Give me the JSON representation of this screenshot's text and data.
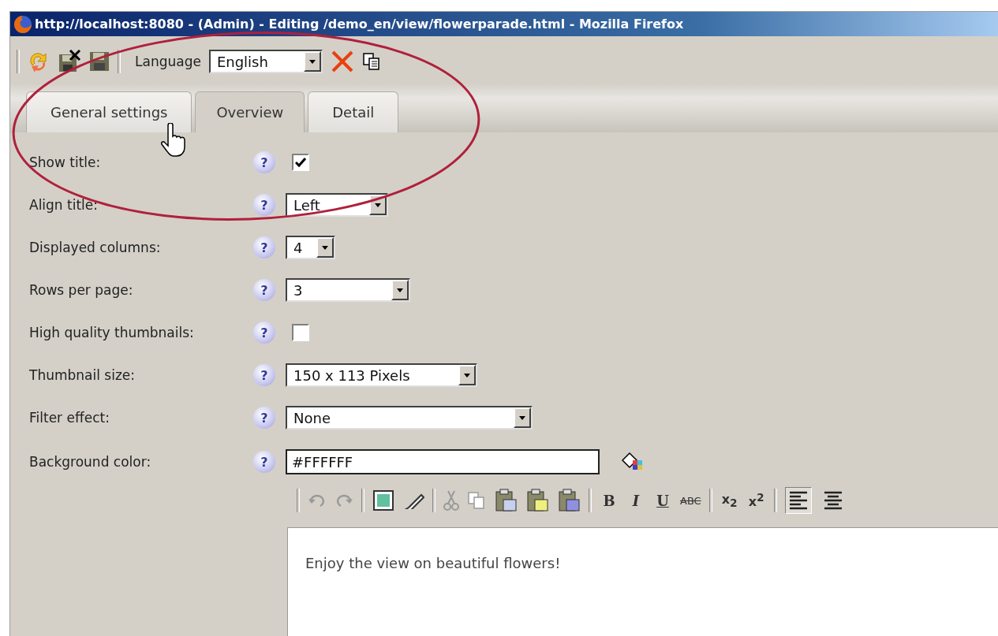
{
  "window": {
    "title": "http://localhost:8080 - (Admin) - Editing /demo_en/view/flowerparade.html - Mozilla Firefox"
  },
  "toolbar": {
    "language_label": "Language",
    "language": {
      "value": "English"
    }
  },
  "tabs": [
    {
      "label": "General settings",
      "selected": false
    },
    {
      "label": "Overview",
      "selected": true
    },
    {
      "label": "Detail",
      "selected": false
    }
  ],
  "fields": [
    {
      "label": "Show title:",
      "help": "?",
      "kind": "checkbox",
      "checked": true
    },
    {
      "label": "Align title:",
      "help": "?",
      "kind": "select",
      "value": "Left"
    },
    {
      "label": "Displayed columns:",
      "help": "?",
      "kind": "select",
      "value": "4"
    },
    {
      "label": "Rows per page:",
      "help": "?",
      "kind": "select",
      "value": "3"
    },
    {
      "label": "High quality thumbnails:",
      "help": "?",
      "kind": "checkbox",
      "checked": false
    },
    {
      "label": "Thumbnail size:",
      "help": "?",
      "kind": "select",
      "value": "150 x 113 Pixels"
    },
    {
      "label": "Filter effect:",
      "help": "?",
      "kind": "select",
      "value": "None"
    },
    {
      "label": "Background color:",
      "help": "?",
      "kind": "color",
      "value": "#FFFFFF"
    }
  ],
  "editor": {
    "format_buttons": [
      {
        "label": "B"
      },
      {
        "label": "I"
      },
      {
        "label": "U"
      },
      {
        "label": "ABC"
      },
      {
        "label": "x$_{2}$"
      },
      {
        "label": "x$^{2}$"
      }
    ],
    "align_buttons": [
      {
        "selected": true
      },
      {
        "selected": false
      }
    ],
    "content": "Enjoy the view on beautiful flowers!"
  }
}
